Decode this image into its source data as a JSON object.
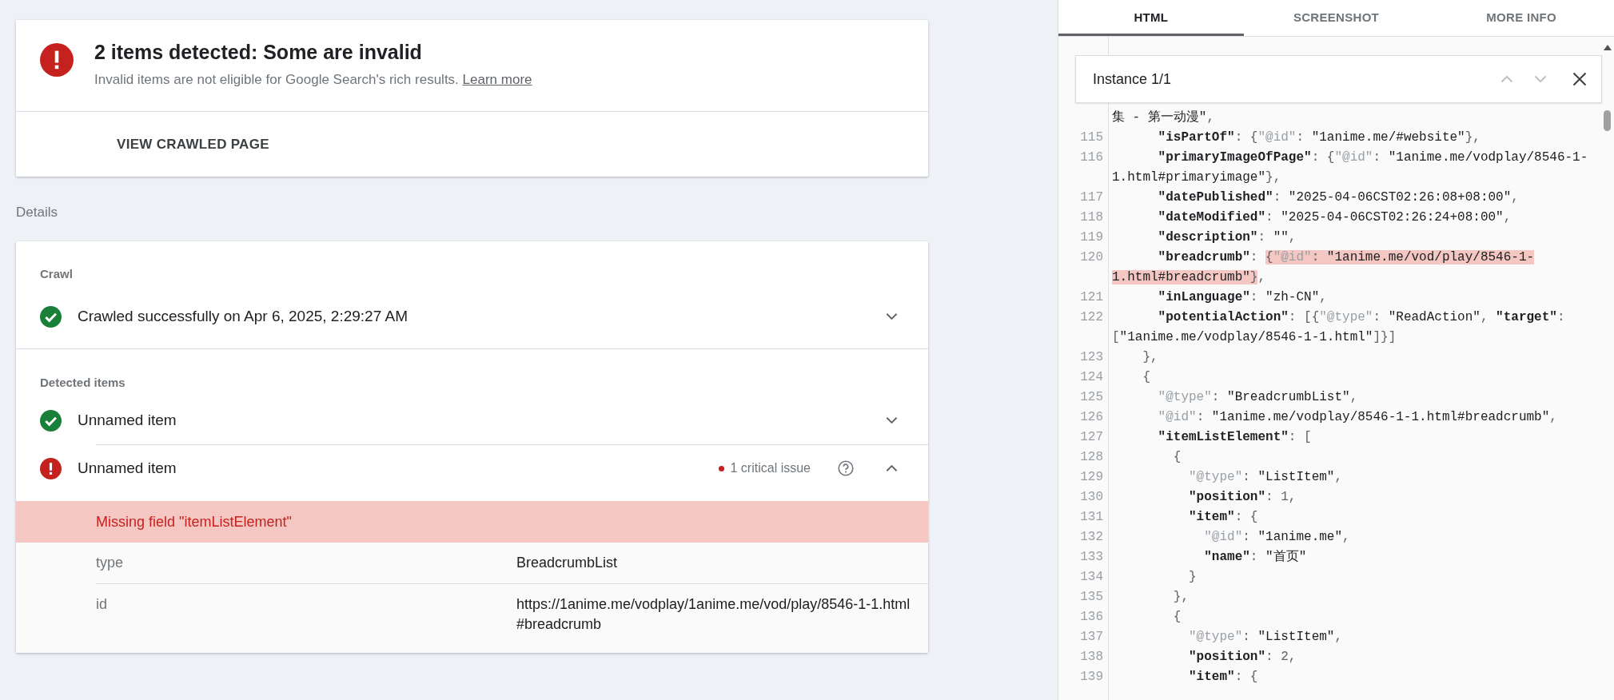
{
  "summary": {
    "title": "2 items detected: Some are invalid",
    "kind": "invalid",
    "text": "Invalid items are not eligible for Google Search's rich results. ",
    "link": "Learn more",
    "action": "VIEW CRAWLED PAGE"
  },
  "details_label": "Details",
  "crawl": {
    "heading": "Crawl",
    "kind": "valid",
    "text": "Crawled successfully on Apr 6, 2025, 2:29:27 AM",
    "expanded": false
  },
  "detected_items": {
    "heading": "Detected items",
    "items": [
      {
        "name": "Unnamed item",
        "kind": "valid",
        "expanded": false
      },
      {
        "name": "Unnamed item",
        "kind": "invalid",
        "expanded": true,
        "issue_count": "1 critical issue",
        "issue": "Missing field \"itemListElement\"",
        "properties": [
          {
            "name": "type",
            "value": "BreadcrumbList"
          },
          {
            "name": "id",
            "value": "https://1anime.me/vodplay/1anime.me/vod/play/8546-1-1.html#breadcrumb"
          }
        ]
      }
    ]
  },
  "panel": {
    "tabs": [
      {
        "label": "HTML",
        "selected": true
      },
      {
        "label": "SCREENSHOT",
        "selected": false
      },
      {
        "label": "MORE INFO",
        "selected": false
      }
    ],
    "find": {
      "label": "Instance 1/1"
    },
    "code": {
      "rows": [
        {
          "segments": [
            {
              "kind": "str",
              "text": "集 - 第一动漫\""
            },
            {
              "kind": "punct",
              "text": ","
            }
          ]
        },
        {
          "num": "115",
          "segments": [
            {
              "kind": "key",
              "text": "      \"isPartOf\""
            },
            {
              "kind": "punct",
              "text": ": {"
            },
            {
              "kind": "meta",
              "text": "\"@id\""
            },
            {
              "kind": "punct",
              "text": ": "
            },
            {
              "kind": "str",
              "text": "\"1anime.me/#website\""
            },
            {
              "kind": "punct",
              "text": "},"
            }
          ]
        },
        {
          "num": "116",
          "segments": [
            {
              "kind": "key",
              "text": "      \"primaryImageOfPage\""
            },
            {
              "kind": "punct",
              "text": ": {"
            },
            {
              "kind": "meta",
              "text": "\"@id\""
            },
            {
              "kind": "punct",
              "text": ": "
            },
            {
              "kind": "str",
              "text": "\"1anime.me/vodplay/8546-1-"
            }
          ]
        },
        {
          "segments": [
            {
              "kind": "str",
              "text": "1.html#primaryimage\""
            },
            {
              "kind": "punct",
              "text": "},"
            }
          ]
        },
        {
          "num": "117",
          "segments": [
            {
              "kind": "key",
              "text": "      \"datePublished\""
            },
            {
              "kind": "punct",
              "text": ": "
            },
            {
              "kind": "str",
              "text": "\"2025-04-06CST02:26:08+08:00\""
            },
            {
              "kind": "punct",
              "text": ","
            }
          ]
        },
        {
          "num": "118",
          "segments": [
            {
              "kind": "key",
              "text": "      \"dateModified\""
            },
            {
              "kind": "punct",
              "text": ": "
            },
            {
              "kind": "str",
              "text": "\"2025-04-06CST02:26:24+08:00\""
            },
            {
              "kind": "punct",
              "text": ","
            }
          ]
        },
        {
          "num": "119",
          "segments": [
            {
              "kind": "key",
              "text": "      \"description\""
            },
            {
              "kind": "punct",
              "text": ": "
            },
            {
              "kind": "str",
              "text": "\"\""
            },
            {
              "kind": "punct",
              "text": ","
            }
          ]
        },
        {
          "num": "120",
          "segments": [
            {
              "kind": "key",
              "text": "      \"breadcrumb\""
            },
            {
              "kind": "punct",
              "text": ": "
            },
            {
              "kind": "punct",
              "text": "{",
              "highlight": true
            },
            {
              "kind": "meta",
              "text": "\"@id\"",
              "highlight": true
            },
            {
              "kind": "punct",
              "text": ": ",
              "highlight": true
            },
            {
              "kind": "str",
              "text": "\"1anime.me/vod/play/8546-1-",
              "highlight": true
            }
          ]
        },
        {
          "segments": [
            {
              "kind": "str",
              "text": "1.html#breadcrumb\"",
              "highlight": true
            },
            {
              "kind": "punct",
              "text": "}",
              "highlight": true
            },
            {
              "kind": "punct",
              "text": ","
            }
          ]
        },
        {
          "num": "121",
          "segments": [
            {
              "kind": "key",
              "text": "      \"inLanguage\""
            },
            {
              "kind": "punct",
              "text": ": "
            },
            {
              "kind": "str",
              "text": "\"zh-CN\""
            },
            {
              "kind": "punct",
              "text": ","
            }
          ]
        },
        {
          "num": "122",
          "segments": [
            {
              "kind": "key",
              "text": "      \"potentialAction\""
            },
            {
              "kind": "punct",
              "text": ": [{"
            },
            {
              "kind": "meta",
              "text": "\"@type\""
            },
            {
              "kind": "punct",
              "text": ": "
            },
            {
              "kind": "str",
              "text": "\"ReadAction\""
            },
            {
              "kind": "punct",
              "text": ", "
            },
            {
              "kind": "key",
              "text": "\"target\""
            },
            {
              "kind": "punct",
              "text": ":"
            }
          ]
        },
        {
          "segments": [
            {
              "kind": "punct",
              "text": "["
            },
            {
              "kind": "str",
              "text": "\"1anime.me/vodplay/8546-1-1.html\""
            },
            {
              "kind": "punct",
              "text": "]}]"
            }
          ]
        },
        {
          "num": "123",
          "segments": [
            {
              "kind": "punct",
              "text": "    },"
            }
          ]
        },
        {
          "num": "124",
          "segments": [
            {
              "kind": "punct",
              "text": "    {"
            }
          ]
        },
        {
          "num": "125",
          "segments": [
            {
              "kind": "meta",
              "text": "      \"@type\""
            },
            {
              "kind": "punct",
              "text": ": "
            },
            {
              "kind": "str",
              "text": "\"BreadcrumbList\""
            },
            {
              "kind": "punct",
              "text": ","
            }
          ]
        },
        {
          "num": "126",
          "segments": [
            {
              "kind": "meta",
              "text": "      \"@id\""
            },
            {
              "kind": "punct",
              "text": ": "
            },
            {
              "kind": "str",
              "text": "\"1anime.me/vodplay/8546-1-1.html#breadcrumb\""
            },
            {
              "kind": "punct",
              "text": ","
            }
          ]
        },
        {
          "num": "127",
          "segments": [
            {
              "kind": "key",
              "text": "      \"itemListElement\""
            },
            {
              "kind": "punct",
              "text": ": ["
            }
          ]
        },
        {
          "num": "128",
          "segments": [
            {
              "kind": "punct",
              "text": "        {"
            }
          ]
        },
        {
          "num": "129",
          "segments": [
            {
              "kind": "meta",
              "text": "          \"@type\""
            },
            {
              "kind": "punct",
              "text": ": "
            },
            {
              "kind": "str",
              "text": "\"ListItem\""
            },
            {
              "kind": "punct",
              "text": ","
            }
          ]
        },
        {
          "num": "130",
          "segments": [
            {
              "kind": "key",
              "text": "          \"position\""
            },
            {
              "kind": "punct",
              "text": ": 1,"
            }
          ]
        },
        {
          "num": "131",
          "segments": [
            {
              "kind": "key",
              "text": "          \"item\""
            },
            {
              "kind": "punct",
              "text": ": {"
            }
          ]
        },
        {
          "num": "132",
          "segments": [
            {
              "kind": "meta",
              "text": "            \"@id\""
            },
            {
              "kind": "punct",
              "text": ": "
            },
            {
              "kind": "str",
              "text": "\"1anime.me\""
            },
            {
              "kind": "punct",
              "text": ","
            }
          ]
        },
        {
          "num": "133",
          "segments": [
            {
              "kind": "key",
              "text": "            \"name\""
            },
            {
              "kind": "punct",
              "text": ": "
            },
            {
              "kind": "str",
              "text": "\"首页\""
            }
          ]
        },
        {
          "num": "134",
          "segments": [
            {
              "kind": "punct",
              "text": "          }"
            }
          ]
        },
        {
          "num": "135",
          "segments": [
            {
              "kind": "punct",
              "text": "        },"
            }
          ]
        },
        {
          "num": "136",
          "segments": [
            {
              "kind": "punct",
              "text": "        {"
            }
          ]
        },
        {
          "num": "137",
          "segments": [
            {
              "kind": "meta",
              "text": "          \"@type\""
            },
            {
              "kind": "punct",
              "text": ": "
            },
            {
              "kind": "str",
              "text": "\"ListItem\""
            },
            {
              "kind": "punct",
              "text": ","
            }
          ]
        },
        {
          "num": "138",
          "segments": [
            {
              "kind": "key",
              "text": "          \"position\""
            },
            {
              "kind": "punct",
              "text": ": 2,"
            }
          ]
        },
        {
          "num": "139",
          "segments": [
            {
              "kind": "key",
              "text": "          \"item\""
            },
            {
              "kind": "punct",
              "text": ": {"
            }
          ]
        }
      ]
    }
  }
}
